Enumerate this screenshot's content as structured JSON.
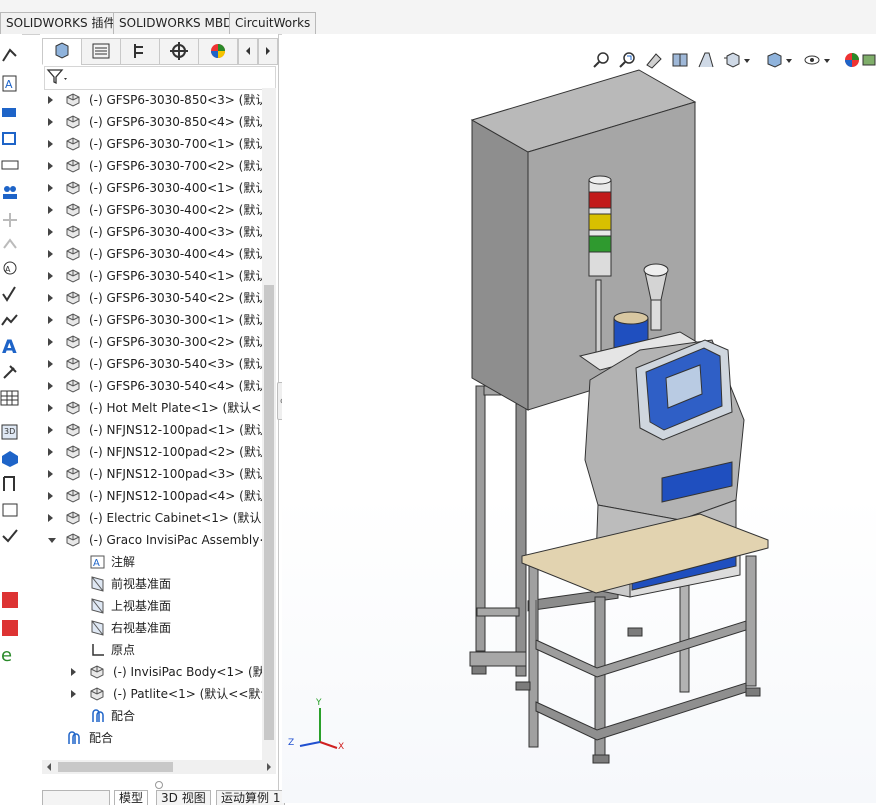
{
  "top_tabs": [
    "SOLIDWORKS 插件",
    "SOLIDWORKS MBD",
    "CircuitWorks"
  ],
  "left_tool_icons": [
    "smart-dimension-icon",
    "note-icon",
    "balloon-icon",
    "auto-balloon-icon",
    "magnetic-line-icon",
    "bom-balloon-icon",
    "stacked-balloon-icon",
    "surface-finish-icon",
    "weld-symbol-icon",
    "datum-feature-icon",
    "geometric-tolerance-icon",
    "datum-target-icon",
    "text-icon",
    "hole-callout-icon",
    "table-icon",
    "3d-view-icon",
    "publish-icon",
    "pdf-icon",
    "ebom-icon"
  ],
  "fm_tabs": [
    "featuremanager-tree-icon",
    "propertymanager-icon",
    "configurationmanager-icon",
    "dimxpert-icon",
    "display-manager-icon"
  ],
  "tree": {
    "parts": [
      {
        "label": "(-) GFSP6-3030-850<3> (默认<"
      },
      {
        "label": "(-) GFSP6-3030-850<4> (默认<"
      },
      {
        "label": "(-) GFSP6-3030-700<1> (默认<"
      },
      {
        "label": "(-) GFSP6-3030-700<2> (默认<"
      },
      {
        "label": "(-) GFSP6-3030-400<1> (默认<"
      },
      {
        "label": "(-) GFSP6-3030-400<2> (默认<"
      },
      {
        "label": "(-) GFSP6-3030-400<3> (默认<"
      },
      {
        "label": "(-) GFSP6-3030-400<4> (默认<"
      },
      {
        "label": "(-) GFSP6-3030-540<1> (默认<"
      },
      {
        "label": "(-) GFSP6-3030-540<2> (默认<"
      },
      {
        "label": "(-) GFSP6-3030-300<1> (默认<"
      },
      {
        "label": "(-) GFSP6-3030-300<2> (默认<"
      },
      {
        "label": "(-) GFSP6-3030-540<3> (默认<"
      },
      {
        "label": "(-) GFSP6-3030-540<4> (默认<"
      },
      {
        "label": "(-) Hot Melt Plate<1> (默认<<"
      },
      {
        "label": "(-) NFJNS12-100pad<1> (默认"
      },
      {
        "label": "(-) NFJNS12-100pad<2> (默认"
      },
      {
        "label": "(-) NFJNS12-100pad<3> (默认"
      },
      {
        "label": "(-) NFJNS12-100pad<4> (默认"
      },
      {
        "label": "(-) Electric Cabinet<1> (默认<"
      },
      {
        "label": "(-) Graco InvisiPac Assembly<"
      }
    ],
    "children": [
      {
        "label": "注解"
      },
      {
        "label": "前视基准面"
      },
      {
        "label": "上视基准面"
      },
      {
        "label": "右视基准面"
      },
      {
        "label": "原点"
      },
      {
        "label": "(-) InvisiPac Body<1> (默认"
      },
      {
        "label": "(-) Patlite<1> (默认<<默认"
      },
      {
        "label": "配合"
      }
    ],
    "mates": {
      "label": "配合"
    }
  },
  "bottom_tabs": [
    "模型",
    "3D 视图",
    "运动算例 1"
  ],
  "triad": {
    "x": "X",
    "y": "Y",
    "z": "Z"
  },
  "colors": {
    "accent_blue": "#1f4fbf",
    "tab_border": "#b9b9b9",
    "cabinet_grey": "#a9a9a9"
  }
}
